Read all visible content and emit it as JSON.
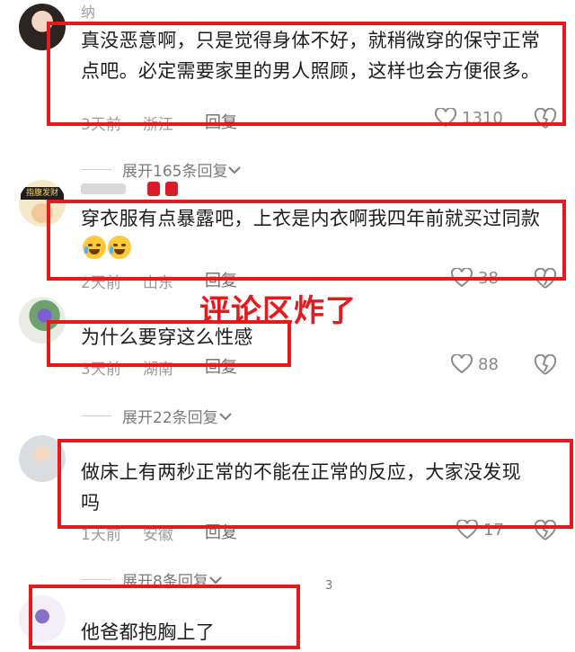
{
  "comments": [
    {
      "username": "纳",
      "text": "真没恶意啊，只是觉得身体不好，就稍微穿的保守正常点吧。必定需要家里的男人照顾，这样也会方便很多。",
      "time": "3天前",
      "location": "浙江",
      "reply_label": "回复",
      "likes": "1310",
      "expand_label": "展开165条回复"
    },
    {
      "username": "",
      "text": "穿衣服有点暴露吧，上衣是内衣啊我四年前就买过同款",
      "time": "2天前",
      "location": "山东",
      "reply_label": "回复",
      "likes": "38"
    },
    {
      "username": "",
      "text": "为什么要穿这么性感",
      "time": "3天前",
      "location": "湖南",
      "reply_label": "回复",
      "likes": "88",
      "expand_label": "展开22条回复"
    },
    {
      "username": "",
      "text": "做床上有两秒正常的不能在正常的反应，大家没发现吗",
      "time": "1天前",
      "location": "安徽",
      "reply_label": "回复",
      "likes": "17",
      "expand_label": "展开8条回复"
    },
    {
      "username": "",
      "text": "他爸都抱胸上了",
      "stray_number": "3"
    }
  ],
  "overlay_caption": "评论区炸了",
  "avatar2_badge": "指腹发财",
  "colors": {
    "highlight": "#e8191d",
    "meta": "#9a9a9a"
  }
}
